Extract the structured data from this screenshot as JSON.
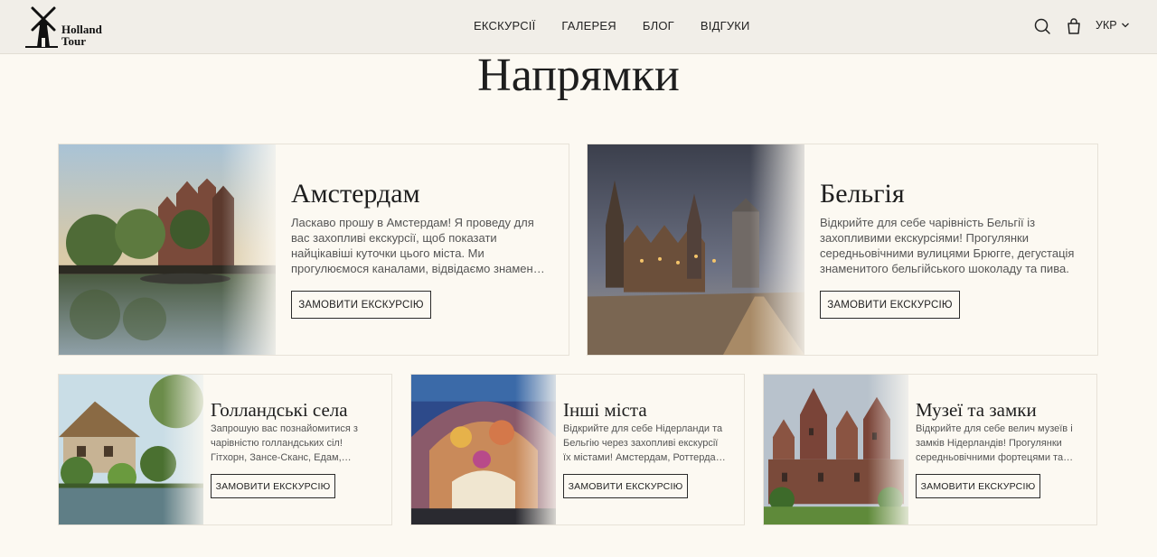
{
  "brand": {
    "line1": "Holland",
    "line2": "Tour"
  },
  "nav": [
    "ЕКСКУРСІЇ",
    "ГАЛЕРЕЯ",
    "БЛОГ",
    "ВІДГУКИ"
  ],
  "language": "УКР",
  "page_title": "Напрямки",
  "cards": [
    {
      "title": "Амстердам",
      "text": "Ласкаво прошу в Амстердам! Я проведу для вас захопливі екскурсії, щоб показати найцікавіші куточки цього міста. Ми прогулюємося каналами, відвідаємо знамениті музеї та побачимо старовинні будинки.",
      "button": "ЗАМОВИТИ ЕКСКУРСІЮ"
    },
    {
      "title": "Бельгія",
      "text": "Відкрийте для себе чарівність Бельгії із захопливими екскурсіями! Прогулянки середньовічними вулицями Брюгге, дегустація знаменитого бельгійського шоколаду та пива.",
      "button": "ЗАМОВИТИ ЕКСКУРСІЮ"
    },
    {
      "title": "Голландські села",
      "text": "Запрошую вас познайомитися з чарівністю голландських сіл! Гітхорн, Зансе-Сканс, Едам, Волендам та інші.",
      "button": "ЗАМОВИТИ ЕКСКУРСІЮ"
    },
    {
      "title": "Інші міста",
      "text": "Відкрийте для себе Нідерланди та Бельгію через захопливі екскурсії їх містами! Амстердам, Роттердам, Гаага, Утрехт та інші.",
      "button": "ЗАМОВИТИ ЕКСКУРСІЮ"
    },
    {
      "title": "Музеї та замки",
      "text": "Відкрийте для себе велич музеїв і замків Нідерландів! Прогулянки середньовічними фортецями та старовинними палацами.",
      "button": "ЗАМОВИТИ ЕКСКУРСІЮ"
    }
  ]
}
